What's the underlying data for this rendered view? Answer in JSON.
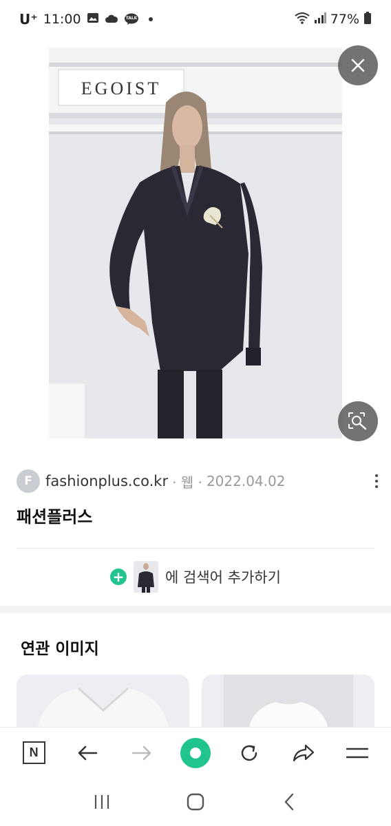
{
  "status_bar": {
    "carrier": "U⁺",
    "time": "11:00",
    "talk_badge": "TALK",
    "battery": "77%"
  },
  "viewer": {
    "store_sign": "EGOIST"
  },
  "source": {
    "favicon_letter": "F",
    "domain": "fashionplus.co.kr",
    "type": "· 웹 ·",
    "date": "2022.04.02",
    "title": "패션플러스"
  },
  "add_search": {
    "plus": "+",
    "label": "에 검색어 추가하기"
  },
  "related": {
    "title": "연관 이미지"
  },
  "toolbar": {
    "naver_label": "N"
  }
}
